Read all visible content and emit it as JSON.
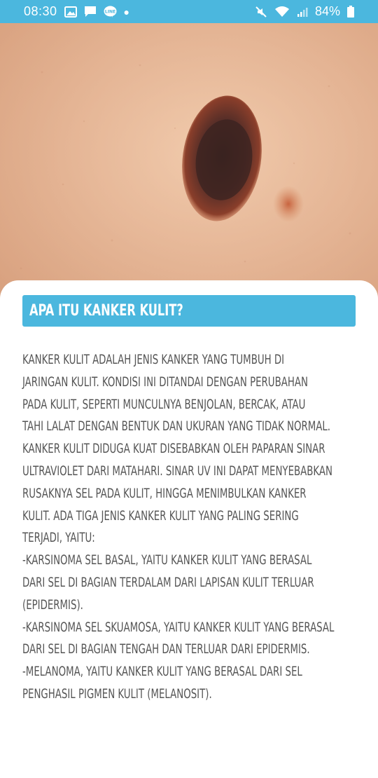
{
  "status_bar": {
    "time": "08:30",
    "battery": "84%",
    "left_icons": [
      "image-icon",
      "message-icon",
      "line-icon",
      "notification-dot"
    ],
    "right_icons": [
      "mute-icon",
      "wifi-icon",
      "signal-icon",
      "battery-icon"
    ],
    "background": "#4bb7de"
  },
  "hero": {
    "image": "skin-mole-photo"
  },
  "section": {
    "title": "APA ITU KANKER KULIT?",
    "accent_color": "#4bb7de"
  },
  "body_lines": [
    "KANKER KULIT ADALAH JENIS KANKER YANG TUMBUH DI",
    "JARINGAN KULIT. KONDISI INI DITANDAI DENGAN PERUBAHAN",
    "PADA KULIT, SEPERTI MUNCULNYA BENJOLAN, BERCAK, ATAU",
    "TAHI LALAT DENGAN BENTUK DAN UKURAN YANG TIDAK NORMAL.",
    "KANKER KULIT DIDUGA KUAT DISEBABKAN OLEH PAPARAN SINAR",
    "ULTRAVIOLET DARI MATAHARI. SINAR UV INI DAPAT MENYEBABKAN",
    "RUSAKNYA SEL PADA KULIT, HINGGA MENIMBULKAN KANKER",
    "KULIT. ADA TIGA JENIS KANKER KULIT YANG PALING SERING",
    "TERJADI, YAITU:",
    "-KARSINOMA SEL BASAL, YAITU KANKER KULIT YANG BERASAL",
    "DARI SEL DI BAGIAN TERDALAM DARI LAPISAN KULIT TERLUAR",
    "(EPIDERMIS).",
    "-KARSINOMA SEL SKUAMOSA, YAITU KANKER KULIT YANG BERASAL",
    "DARI SEL DI BAGIAN TENGAH DAN TERLUAR DARI EPIDERMIS.",
    "-MELANOMA, YAITU KANKER KULIT YANG BERASAL DARI SEL",
    "PENGHASIL PIGMEN KULIT (MELANOSIT)."
  ]
}
